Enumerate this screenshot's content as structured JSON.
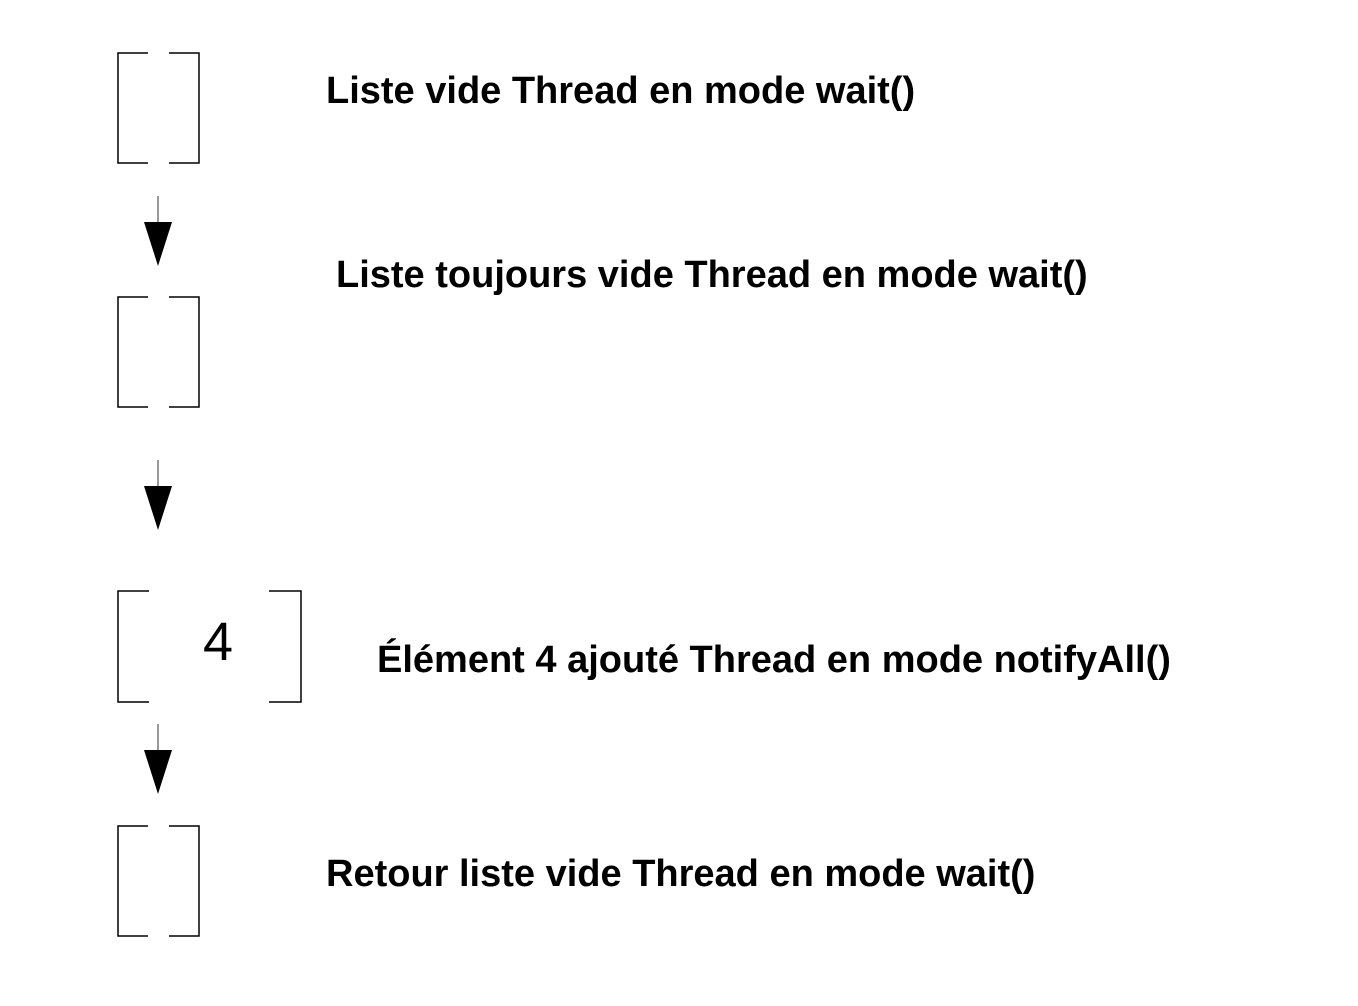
{
  "diagram": {
    "steps": [
      {
        "label": "Liste vide Thread en mode wait()",
        "list_content": ""
      },
      {
        "label": "Liste toujours vide Thread en mode wait()",
        "list_content": ""
      },
      {
        "label": "Élément 4 ajouté Thread en mode notifyAll()",
        "list_content": "4"
      },
      {
        "label": "Retour liste vide Thread en mode wait()",
        "list_content": ""
      }
    ],
    "colors": {
      "stroke": "#000000",
      "background": "#ffffff",
      "arrow_line": "#777777"
    }
  }
}
